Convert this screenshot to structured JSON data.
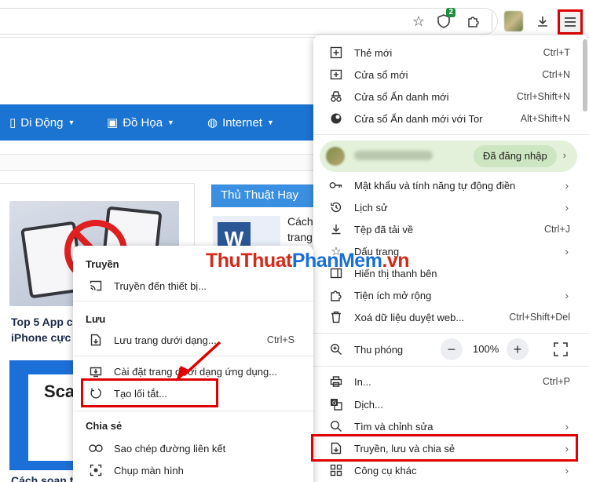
{
  "toolbar": {
    "extension_badge": "2"
  },
  "page": {
    "nav": [
      {
        "label": "Di Động"
      },
      {
        "label": "Đồ Họa"
      },
      {
        "label": "Internet"
      }
    ],
    "article1_title_line1": "Top 5 App c",
    "article1_title_line2": "iPhone cực",
    "article2_thumb_text": "Sca",
    "article2_title": "Cách soạn t",
    "side_tab": "Thủ Thuật Hay",
    "side_text_1": "Cách",
    "side_text_2": "trang",
    "watermark_1": "ThuThuat",
    "watermark_2": "PhanMem",
    "watermark_3": ".vn"
  },
  "main_menu": {
    "new_tab": {
      "label": "Thẻ mới",
      "shortcut": "Ctrl+T"
    },
    "new_window": {
      "label": "Cửa sổ mới",
      "shortcut": "Ctrl+N"
    },
    "incognito": {
      "label": "Cửa sổ Ẩn danh mới",
      "shortcut": "Ctrl+Shift+N"
    },
    "incognito_tor": {
      "label": "Cửa sổ Ẩn danh mới với Tor",
      "shortcut": "Alt+Shift+N"
    },
    "profile_status": "Đã đăng nhập",
    "passwords": {
      "label": "Mật khẩu và tính năng tự động điền"
    },
    "history": {
      "label": "Lịch sử"
    },
    "downloads": {
      "label": "Tệp đã tải về",
      "shortcut": "Ctrl+J"
    },
    "bookmarks": {
      "label": "Dấu trang"
    },
    "sidebar": {
      "label": "Hiển thị thanh bên"
    },
    "extensions": {
      "label": "Tiện ích mở rộng"
    },
    "clear_data": {
      "label": "Xoá dữ liệu duyệt web...",
      "shortcut": "Ctrl+Shift+Del"
    },
    "zoom": {
      "label": "Thu phóng",
      "value": "100%"
    },
    "print": {
      "label": "In...",
      "shortcut": "Ctrl+P"
    },
    "translate": {
      "label": "Dịch..."
    },
    "find_edit": {
      "label": "Tìm và chỉnh sửa"
    },
    "cast_save_share": {
      "label": "Truyền, lưu và chia sẻ"
    },
    "more_tools": {
      "label": "Công cụ khác"
    }
  },
  "sub_menu": {
    "cast_header": "Truyền",
    "cast_device": "Truyền đến thiết bị...",
    "save_header": "Lưu",
    "save_page": {
      "label": "Lưu trang dưới dạng...",
      "shortcut": "Ctrl+S"
    },
    "install_app": "Cài đặt trang dưới dạng ứng dụng...",
    "create_shortcut": "Tạo lối tắt...",
    "share_header": "Chia sẻ",
    "copy_link": "Sao chép đường liên kết",
    "screenshot": "Chụp màn hình"
  },
  "colors": {
    "accent_red": "#e00000",
    "nav_blue": "#1b74d1",
    "profile_green": "#e3f1da"
  }
}
